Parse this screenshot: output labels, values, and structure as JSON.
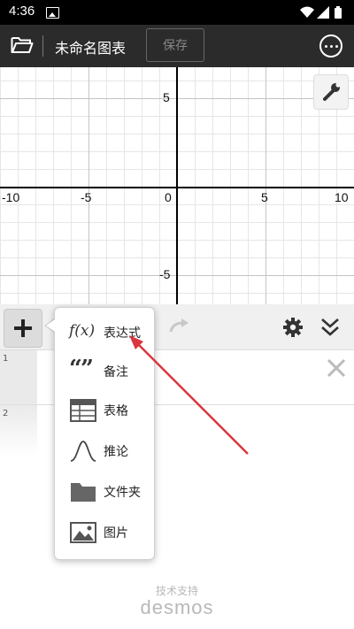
{
  "status_bar": {
    "time": "4:36"
  },
  "app_bar": {
    "title": "未命名图表",
    "save_label": "保存"
  },
  "graph": {
    "x_ticks": [
      "-10",
      "-5",
      "0",
      "5",
      "10"
    ],
    "y_ticks": [
      "5",
      "-5"
    ],
    "x_range": [
      -10,
      10
    ],
    "y_range": [
      -6,
      6
    ]
  },
  "expression_list": {
    "rows": [
      {
        "number": "1"
      },
      {
        "number": "2"
      }
    ]
  },
  "add_menu": {
    "items": [
      {
        "label": "表达式",
        "icon": "function-icon"
      },
      {
        "label": "备注",
        "icon": "quote-icon"
      },
      {
        "label": "表格",
        "icon": "table-icon"
      },
      {
        "label": "推论",
        "icon": "distribution-icon"
      },
      {
        "label": "文件夹",
        "icon": "folder-icon"
      },
      {
        "label": "图片",
        "icon": "image-icon"
      }
    ],
    "function_glyph": "f(x)",
    "quote_glyph": "“”"
  },
  "credit": {
    "line1": "技术支持",
    "brand": "desmos"
  },
  "colors": {
    "annotation_arrow": "#d9363e",
    "app_bar": "#2b2b2b"
  }
}
